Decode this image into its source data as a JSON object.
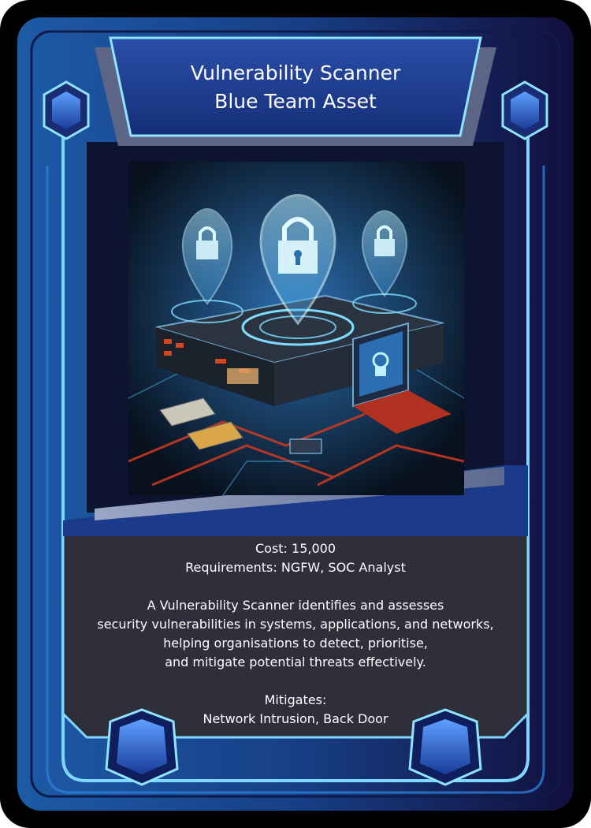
{
  "card": {
    "title_line1": "Vulnerability Scanner",
    "title_line2": "Blue Team Asset",
    "cost": "Cost: 15,000",
    "requirements": "Requirements: NGFW, SOC Analyst",
    "description": [
      "A Vulnerability Scanner identifies and assesses",
      "security vulnerabilities in systems, applications, and networks,",
      "helping organisations to detect, prioritise,",
      "and mitigate potential threats effectively."
    ],
    "mitigates_label": "Mitigates:",
    "mitigates_value": "Network Intrusion, Back Door"
  },
  "colors": {
    "frame_dark": "#0b1030",
    "frame_blue": "#1f5fae",
    "neon": "#6fd3ff",
    "title_panel": "#1f3d8f",
    "text_panel": "#2e2f3a",
    "accent_red": "#d23a22"
  },
  "icons": [
    "hexagon-gem-icon",
    "padlock-icon",
    "server-icon",
    "laptop-icon"
  ]
}
